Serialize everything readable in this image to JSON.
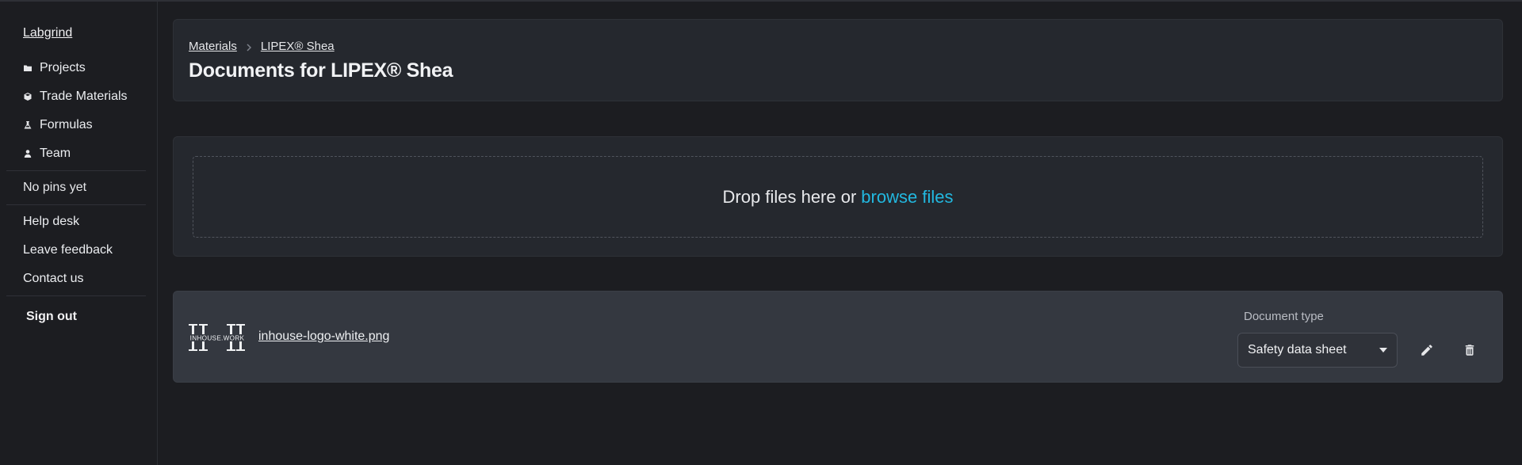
{
  "sidebar": {
    "brand": "Labgrind",
    "nav": [
      {
        "label": "Projects",
        "icon": "folder-icon"
      },
      {
        "label": "Trade Materials",
        "icon": "cube-icon"
      },
      {
        "label": "Formulas",
        "icon": "flask-icon"
      },
      {
        "label": "Team",
        "icon": "person-icon"
      }
    ],
    "pins_empty": "No pins yet",
    "help": [
      "Help desk",
      "Leave feedback",
      "Contact us"
    ],
    "sign_out": "Sign out"
  },
  "header": {
    "breadcrumb": [
      "Materials",
      "LIPEX® Shea"
    ],
    "title": "Documents for LIPEX® Shea"
  },
  "upload": {
    "prompt": "Drop files here or",
    "browse": "browse files"
  },
  "files": [
    {
      "name": "inhouse-logo-white.png",
      "logo_text": "INHOUSE.WORK",
      "doc_type_label": "Document type",
      "doc_type_value": "Safety data sheet"
    }
  ],
  "colors": {
    "background": "#1c1d21",
    "panel": "#25282e",
    "file_card": "#343840",
    "accent_link": "#22b8e0"
  }
}
